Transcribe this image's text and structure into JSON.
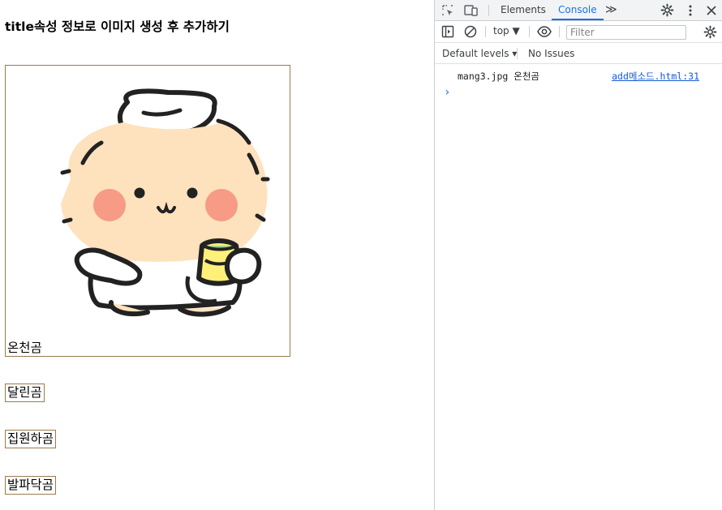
{
  "page": {
    "heading": "title속성 정보로 이미지 생성 후 추가하기",
    "image_caption": "온천곰",
    "items": [
      "달린곰",
      "집원하곰",
      "발파닥곰"
    ],
    "border_color": "#9a7b4f"
  },
  "devtools": {
    "tabs": {
      "elements": "Elements",
      "console": "Console",
      "more": "≫"
    },
    "context": "top ▼",
    "filter_placeholder": "Filter",
    "levels": "Default levels ▾",
    "issues": "No Issues",
    "message": {
      "text": "mang3.jpg 온천곰",
      "source": "add메소드.html:31"
    },
    "prompt": "›",
    "accent_color": "#1a73e8"
  },
  "icons": [
    "inspect-icon",
    "device-toggle-icon",
    "settings-gear-icon",
    "kebab-menu-icon",
    "close-icon",
    "sidebar-toggle-icon",
    "clear-console-icon",
    "eye-icon",
    "console-settings-icon"
  ]
}
